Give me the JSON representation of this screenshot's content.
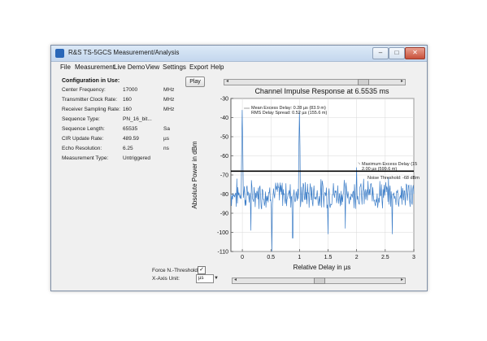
{
  "window": {
    "title": "R&S TS-5GCS Measurement/Analysis",
    "controls": {
      "minimize": "–",
      "maximize": "□",
      "close": "✕"
    }
  },
  "menu": [
    "File",
    "Measurement",
    "Live Demo",
    "View",
    "Settings",
    "Export",
    "Help"
  ],
  "config": {
    "title": "Configuration in Use:",
    "rows": [
      {
        "label": "Center Frequency:",
        "value": "17000",
        "unit": "MHz"
      },
      {
        "label": "Transmitter Clock Rate:",
        "value": "160",
        "unit": "MHz"
      },
      {
        "label": "Receiver Sampling Rate:",
        "value": "160",
        "unit": "MHz"
      },
      {
        "label": "Sequence Type:",
        "value": "PN_16_bit...",
        "unit": ""
      },
      {
        "label": "Sequence Length:",
        "value": "65535",
        "unit": "Sa"
      },
      {
        "label": "CIR Update Rate:",
        "value": "489.59",
        "unit": "µs"
      },
      {
        "label": "Echo Resolution:",
        "value": "6.25",
        "unit": "ns"
      },
      {
        "label": "Measurement Type:",
        "value": "Untriggered",
        "unit": ""
      }
    ]
  },
  "controls": {
    "play_label": "Play",
    "force_threshold_label": "Force N.-Threshold:",
    "force_threshold_checked": "✓",
    "x_axis_unit_label": "X-Axis Unit:",
    "x_axis_unit_value": "µs",
    "top_slider_position": 0.78,
    "bottom_slider_position": 0.5
  },
  "chart_data": {
    "type": "line",
    "title": "Channel Impulse Response at 6.5535 ms",
    "xlabel": "Relative Delay in µs",
    "ylabel": "Absolute Power in dBm",
    "xlim": [
      -0.2,
      3
    ],
    "ylim": [
      -110,
      -30
    ],
    "xticks": [
      "0",
      "0.5",
      "1",
      "1.5",
      "2",
      "2.5",
      "3"
    ],
    "yticks": [
      "-30",
      "-40",
      "-50",
      "-60",
      "-70",
      "-80",
      "-90",
      "-100",
      "-110"
    ],
    "grid": true,
    "series_color": "#3d7ec8",
    "noise_threshold": -68,
    "noise_floor_mean": -80,
    "peaks": [
      {
        "x": 0.0,
        "y": -36
      },
      {
        "x": 1.0,
        "y": -37
      },
      {
        "x": 2.0,
        "y": -66
      }
    ],
    "dips": [
      {
        "x": 0.52,
        "y": -110
      },
      {
        "x": 0.88,
        "y": -103
      },
      {
        "x": 1.5,
        "y": -101
      },
      {
        "x": 2.62,
        "y": -101
      },
      {
        "x": 0.15,
        "y": -99
      },
      {
        "x": 1.8,
        "y": -98
      }
    ],
    "annotations": {
      "mean_excess": "Mean Excess Delay: 0.28 µs (83.9 m)",
      "rms_spread": "RMS Delay Spread: 0.52 µs (155.6 m)",
      "max_excess_1": "Maximum Excess Delay (15",
      "max_excess_2": "2.00 µs (599.6 m)",
      "noise_threshold": "Noise Threshold: -68 dBm"
    }
  }
}
